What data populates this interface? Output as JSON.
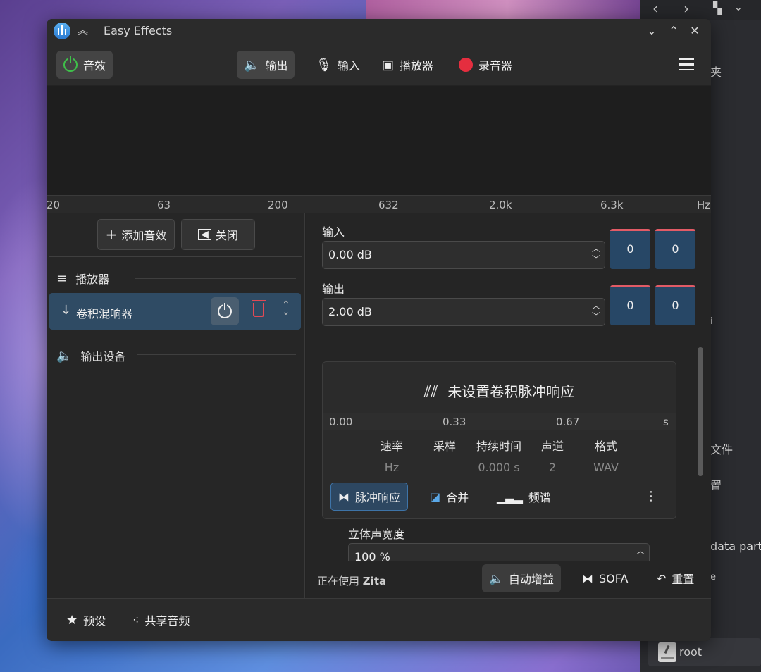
{
  "window": {
    "title": "Easy Effects"
  },
  "header": {
    "effects_label": "音效",
    "output_label": "输出",
    "input_label": "输入",
    "players_label": "播放器",
    "recorders_label": "录音器"
  },
  "freq_axis": {
    "ticks": [
      "20",
      "63",
      "200",
      "632",
      "2.0k",
      "6.3k",
      "Hz"
    ]
  },
  "left": {
    "add_effect": "添加音效",
    "close": "关闭",
    "players_section": "播放器",
    "plugin_name": "卷积混响器",
    "output_devices_section": "输出设备"
  },
  "levels": {
    "input_label": "输入",
    "input_value": "0.00 dB",
    "input_meter_l": "0",
    "input_meter_r": "0",
    "output_label": "输出",
    "output_value": "2.00 dB",
    "output_meter_l": "0",
    "output_meter_r": "0"
  },
  "impulse": {
    "title": "未设置卷积脉冲响应",
    "axis": [
      "0.00",
      "0.33",
      "0.67",
      "s"
    ],
    "columns": [
      {
        "header": "速率",
        "value": "Hz"
      },
      {
        "header": "采样",
        "value": ""
      },
      {
        "header": "持续时间",
        "value": "0.000 s"
      },
      {
        "header": "声道",
        "value": "2"
      },
      {
        "header": "格式",
        "value": "WAV"
      }
    ],
    "tab_impulse": "脉冲响应",
    "tab_combine": "合并",
    "tab_spectrum": "频谱"
  },
  "stereo": {
    "label": "立体声宽度",
    "value": "100 %"
  },
  "status": {
    "using_prefix": "正在使用",
    "using_name": "Zita",
    "autogain": "自动增益",
    "sofa": "SOFA",
    "reset": "重置"
  },
  "footer": {
    "presets": "预设",
    "share_audio": "共享音频"
  },
  "side_panel": {
    "items": [
      "夹",
      "i",
      "文件",
      "置",
      "data part",
      "e"
    ],
    "root_label": "root"
  },
  "colors": {
    "accent": "#3e74a8",
    "record": "#e52e3f",
    "power_on": "#3fbf4a",
    "meter_peak": "#e25b66"
  }
}
